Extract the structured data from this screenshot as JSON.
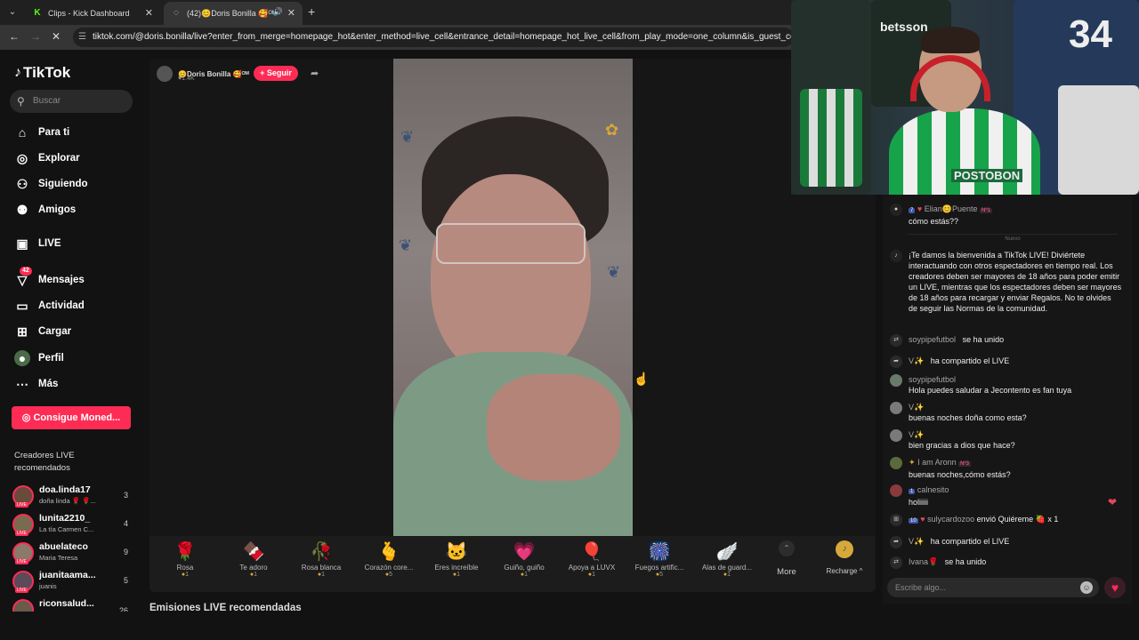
{
  "browser": {
    "tabs": [
      {
        "title": "Clips - Kick Dashboard",
        "icon": "kick-icon"
      },
      {
        "title": "(42)😊Doris Bonilla 🥰ᴼᴹ",
        "icon": "loading-icon"
      }
    ],
    "url": "tiktok.com/@doris.bonilla/live?enter_from_merge=homepage_hot&enter_method=live_cell&entrance_detail=homepage_hot_live_cell&from_play_mode=one_column&is_guest_connect=0&is"
  },
  "sidebar": {
    "logo": "TikTok",
    "search_placeholder": "Buscar",
    "nav": [
      {
        "label": "Para ti",
        "icon": "home-icon"
      },
      {
        "label": "Explorar",
        "icon": "compass-icon"
      },
      {
        "label": "Siguiendo",
        "icon": "following-icon"
      },
      {
        "label": "Amigos",
        "icon": "friends-icon"
      },
      {
        "label": "LIVE",
        "icon": "live-icon"
      },
      {
        "label": "Mensajes",
        "icon": "messages-icon",
        "badge": "42"
      },
      {
        "label": "Actividad",
        "icon": "activity-icon"
      },
      {
        "label": "Cargar",
        "icon": "upload-icon"
      },
      {
        "label": "Perfil",
        "icon": "profile-icon"
      },
      {
        "label": "Más",
        "icon": "more-icon"
      }
    ],
    "coins_button": "Consigue Moned...",
    "recommended_title": "Creadores LIVE recomendados",
    "creators": [
      {
        "name": "doa.linda17",
        "sub": "doña linda 🌹 🌹...",
        "count": "3"
      },
      {
        "name": "lunita2210_",
        "sub": "La tía Carmen C...",
        "count": "4"
      },
      {
        "name": "abuelateco",
        "sub": "Maria Teresa",
        "count": "9"
      },
      {
        "name": "juanitaama...",
        "sub": "juanis",
        "count": "5"
      },
      {
        "name": "riconsalud...",
        "sub": "",
        "count": "26"
      }
    ]
  },
  "live": {
    "host_name": "😊Doris Bonilla 🥰ᴼᴹ",
    "likes": "♥1.4K",
    "follow_label": "+ Seguir",
    "gifts": [
      {
        "name": "Rosa",
        "price": "1",
        "icon": "🌹"
      },
      {
        "name": "Te adoro",
        "price": "1",
        "icon": "🍫"
      },
      {
        "name": "Rosa blanca",
        "price": "1",
        "icon": "🥀"
      },
      {
        "name": "Corazón core...",
        "price": "5",
        "icon": "🫰"
      },
      {
        "name": "Eres increíble",
        "price": "1",
        "icon": "🐱"
      },
      {
        "name": "Guiño, guiño",
        "price": "1",
        "icon": "💗"
      },
      {
        "name": "Apoya a LUVX",
        "price": "1",
        "icon": "🎈"
      },
      {
        "name": "Fuegos artific...",
        "price": "5",
        "icon": "🎆"
      },
      {
        "name": "Alas de guard...",
        "price": "1",
        "icon": "🪽"
      }
    ],
    "more_label": "More",
    "recharge_label": "Recharge ^",
    "section_below": "Emisiones LIVE recomendadas"
  },
  "webcam": {
    "sponsor": "betsson",
    "number": "34",
    "jersey_text": "POSTOBON"
  },
  "chat": {
    "divider": "Nuevo",
    "messages": [
      {
        "user": "Elian😊Puente",
        "level": "7",
        "rank": "Nº1",
        "text": "cómo estás??"
      },
      {
        "user": "",
        "text": "¡Te damos la bienvenida a TikTok LIVE! Diviértete interactuando con otros espectadores en tiempo real. Los creadores deben ser mayores de 18 años para poder emitir un LIVE, mientras que los espectadores deben ser mayores de 18 años para recargar y enviar Regalos. No te olvides de seguir las Normas de la comunidad."
      },
      {
        "user": "soypipefutbol",
        "text": "se ha unido"
      },
      {
        "user": "V✨",
        "text": "ha compartido el LIVE"
      },
      {
        "user": "soypipefutbol",
        "text": "Hola puedes saludar a Jecontento es fan tuya"
      },
      {
        "user": "V✨",
        "text": "buenas noches doña como esta?"
      },
      {
        "user": "V✨",
        "text": "bien gracias a dios que hace?"
      },
      {
        "user": "I am Aronn",
        "rank": "Nº3",
        "text": "buenas noches,cómo estás?"
      },
      {
        "user": "calnesito",
        "level": "1",
        "text": "holiiiii"
      },
      {
        "user": "sulycardozoo",
        "level": "10",
        "text": "envió Quiéreme 🍓 x 1"
      },
      {
        "user": "V✨",
        "text": "ha compartido el LIVE"
      },
      {
        "user": "Ivana🌹",
        "text": "se ha unido"
      }
    ],
    "input_placeholder": "Escribe algo..."
  }
}
